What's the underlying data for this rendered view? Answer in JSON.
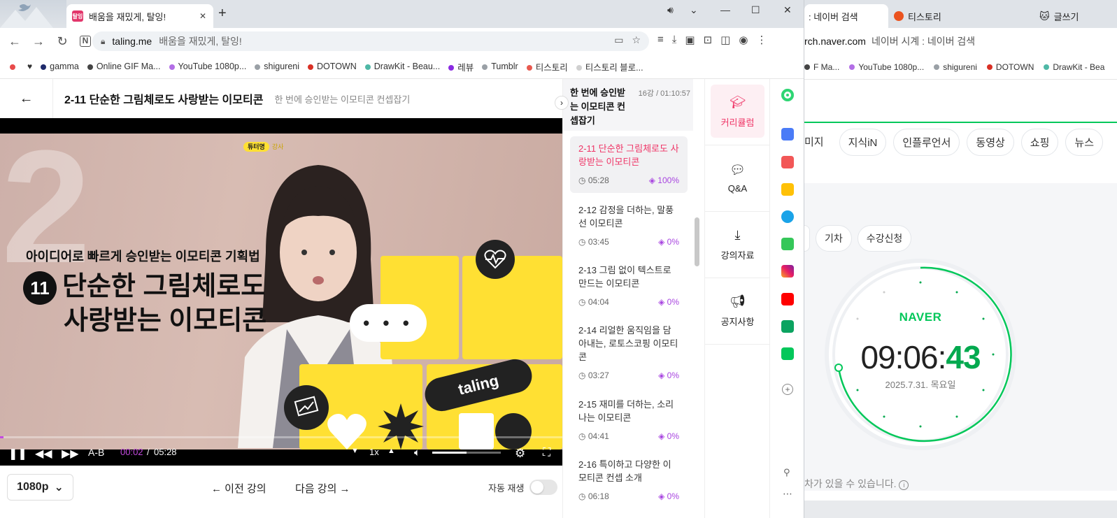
{
  "main_window": {
    "tab": {
      "title": "배움을 재밌게, 탈잉!",
      "favicon_text": "탈잉"
    },
    "omnibox": {
      "url": "taling.me",
      "page_title": "배움을 재밌게, 탈잉!"
    },
    "bookmarks": [
      {
        "label": "",
        "color": "#e84a4a"
      },
      {
        "label": "",
        "color": "#111111",
        "icon": "heart-icon"
      },
      {
        "label": "gamma",
        "color": "#1f2a6b"
      },
      {
        "label": "Online GIF Ma...",
        "color": "#444444"
      },
      {
        "label": "YouTube 1080p...",
        "color": "#b36ee6"
      },
      {
        "label": "shigureni",
        "color": "#9aa0a6"
      },
      {
        "label": "DOTOWN",
        "color": "#d93025"
      },
      {
        "label": "DrawKit - Beau...",
        "color": "#4fb8a6"
      },
      {
        "label": "레뷰",
        "color": "#8a2be2"
      },
      {
        "label": "Tumblr",
        "color": "#9aa0a6"
      },
      {
        "label": "티스토리",
        "color": "#e8594f"
      },
      {
        "label": "티스토리 블로...",
        "color": "#d0d0d0"
      }
    ]
  },
  "lecture": {
    "title": "2-11 단순한 그림체로도 사랑받는 이모티콘",
    "course": "한 번에 승인받는 이모티콘 컨셉잡기",
    "slide": {
      "tag_badge": "튜터명",
      "tag_text": "강사",
      "subtitle": "아이디어로 빠르게 승인받는 이모티콘 기획법",
      "number": "11",
      "main_line1": "단순한 그림체로도",
      "main_line2": "사랑받는 이모티콘",
      "brand": "taling",
      "bubble": "• • •"
    },
    "player": {
      "current_time": "00:02",
      "separator": "/",
      "duration": "05:28",
      "ab_label": "A-B",
      "speed": "1x",
      "progress": 0.006,
      "volume": 0.5
    },
    "below": {
      "quality": "1080p",
      "prev": "이전 강의",
      "next": "다음 강의",
      "autoplay": "자동 재생",
      "autoplay_on": false
    }
  },
  "curriculum": {
    "title": "한 번에 승인받는 이모티콘 컨셉잡기",
    "meta": "16강 / 01:10:57",
    "lessons": [
      {
        "title": "2-11 단순한 그림체로도 사랑받는 이모티콘",
        "duration": "05:28",
        "progress": "100%",
        "active": true
      },
      {
        "title": "2-12 감정을 더하는, 말풍선 이모티콘",
        "duration": "03:45",
        "progress": "0%"
      },
      {
        "title": "2-13 그림 없이 텍스트로 만드는 이모티콘",
        "duration": "04:04",
        "progress": "0%"
      },
      {
        "title": "2-14 리얼한 움직임을 담아내는, 로토스코핑 이모티콘",
        "duration": "03:27",
        "progress": "0%"
      },
      {
        "title": "2-15 재미를 더하는, 소리 나는 이모티콘",
        "duration": "04:41",
        "progress": "0%"
      },
      {
        "title": "2-16 특이하고 다양한 이모티콘 컨셉 소개",
        "duration": "06:18",
        "progress": "0%"
      }
    ]
  },
  "side_menu": [
    {
      "label": "커리큘럼",
      "icon": "graduation-cap-icon",
      "active": true
    },
    {
      "label": "Q&A",
      "icon": "chat-bubble-icon"
    },
    {
      "label": "강의자료",
      "icon": "download-icon"
    },
    {
      "label": "공지사항",
      "icon": "megaphone-icon"
    }
  ],
  "bg_window": {
    "tabs": [
      {
        "title": ": 네이버 검색"
      },
      {
        "title": "티스토리"
      },
      {
        "title": "글쓰기"
      }
    ],
    "url_fragment": "rch.naver.com",
    "page_title": "네이버 시계 : 네이버 검색",
    "bookmarks": [
      {
        "label": "F Ma...",
        "color": "#444444"
      },
      {
        "label": "YouTube 1080p...",
        "color": "#b36ee6"
      },
      {
        "label": "shigureni",
        "color": "#9aa0a6"
      },
      {
        "label": "DOTOWN",
        "color": "#d93025"
      },
      {
        "label": "DrawKit - Bea",
        "color": "#4fb8a6"
      }
    ],
    "search_tabs": [
      "미지",
      "지식iN",
      "인플루언서",
      "동영상",
      "쇼핑",
      "뉴스"
    ],
    "chips": [
      "기차",
      "수강신청"
    ],
    "clock": {
      "brand": "NAVER",
      "hm": "09:06:",
      "seconds": "43",
      "date": "2025.7.31. 목요일"
    },
    "note": "차가 있을 수 있습니다."
  },
  "colors": {
    "accent_pink": "#ef3466",
    "progress_purple": "#a845e0",
    "naver_green": "#03c75a",
    "slide_yellow": "#ffe033"
  }
}
